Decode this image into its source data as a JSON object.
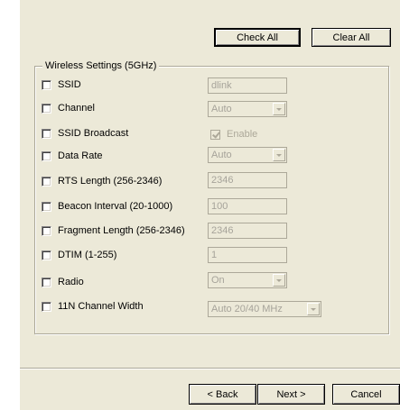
{
  "top_buttons": {
    "check_all": "Check All",
    "clear_all": "Clear All"
  },
  "group": {
    "title": "Wireless Settings (5GHz)",
    "rows": [
      {
        "label": "SSID",
        "control": "text",
        "value": "dlink"
      },
      {
        "label": "Channel",
        "control": "select",
        "value": "Auto"
      },
      {
        "label": "SSID Broadcast",
        "control": "checkbox",
        "value": "Enable"
      },
      {
        "label": "Data Rate",
        "control": "select",
        "value": "Auto"
      },
      {
        "label": "RTS Length (256-2346)",
        "control": "text",
        "value": "2346"
      },
      {
        "label": "Beacon Interval (20-1000)",
        "control": "text",
        "value": "100"
      },
      {
        "label": "Fragment Length (256-2346)",
        "control": "text",
        "value": "2346"
      },
      {
        "label": "DTIM (1-255)",
        "control": "text",
        "value": "1"
      },
      {
        "label": "Radio",
        "control": "select",
        "value": "On"
      },
      {
        "label": "11N Channel Width",
        "control": "select",
        "value": "Auto 20/40 MHz"
      }
    ]
  },
  "nav": {
    "back": "< Back",
    "next": "Next >",
    "cancel": "Cancel"
  }
}
